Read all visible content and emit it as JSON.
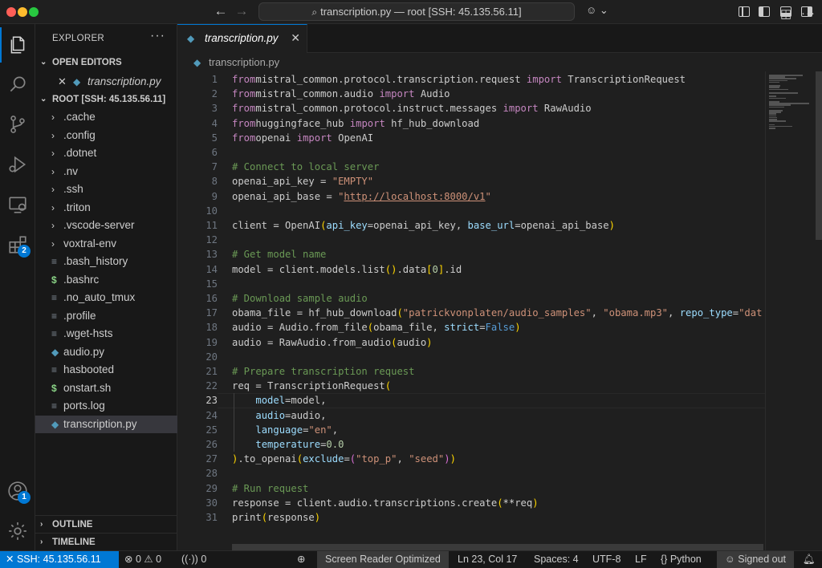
{
  "window": {
    "title": "transcription.py — root [SSH: 45.135.56.11]",
    "back_icon": "arrow-left-icon",
    "forward_icon": "arrow-right-icon",
    "copilot_icon": "copilot-icon"
  },
  "activity_bar": {
    "items": [
      {
        "name": "explorer",
        "icon": "files-icon",
        "active": true
      },
      {
        "name": "search",
        "icon": "search-icon"
      },
      {
        "name": "source-control",
        "icon": "source-control-icon"
      },
      {
        "name": "run-debug",
        "icon": "run-debug-icon"
      },
      {
        "name": "remote-explorer",
        "icon": "remote-explorer-icon"
      },
      {
        "name": "extensions",
        "icon": "extensions-icon",
        "badge": "2"
      }
    ],
    "bottom": [
      {
        "name": "accounts",
        "icon": "account-icon",
        "badge": "1"
      },
      {
        "name": "manage",
        "icon": "gear-icon"
      }
    ]
  },
  "sidebar": {
    "title": "EXPLORER",
    "open_editors_label": "OPEN EDITORS",
    "open_editors": [
      {
        "label": "transcription.py",
        "icon": "python-file-icon"
      }
    ],
    "root_label": "ROOT [SSH: 45.135.56.11]",
    "tree": [
      {
        "label": ".cache",
        "type": "folder"
      },
      {
        "label": ".config",
        "type": "folder"
      },
      {
        "label": ".dotnet",
        "type": "folder"
      },
      {
        "label": ".nv",
        "type": "folder"
      },
      {
        "label": ".ssh",
        "type": "folder"
      },
      {
        "label": ".triton",
        "type": "folder"
      },
      {
        "label": ".vscode-server",
        "type": "folder"
      },
      {
        "label": "voxtral-env",
        "type": "folder"
      },
      {
        "label": ".bash_history",
        "type": "file",
        "icon": "text-file-icon"
      },
      {
        "label": ".bashrc",
        "type": "file",
        "icon": "shell-file-icon"
      },
      {
        "label": ".no_auto_tmux",
        "type": "file",
        "icon": "text-file-icon"
      },
      {
        "label": ".profile",
        "type": "file",
        "icon": "text-file-icon"
      },
      {
        "label": ".wget-hsts",
        "type": "file",
        "icon": "text-file-icon"
      },
      {
        "label": "audio.py",
        "type": "file",
        "icon": "python-file-icon"
      },
      {
        "label": "hasbooted",
        "type": "file",
        "icon": "text-file-icon"
      },
      {
        "label": "onstart.sh",
        "type": "file",
        "icon": "shell-file-icon"
      },
      {
        "label": "ports.log",
        "type": "file",
        "icon": "text-file-icon"
      },
      {
        "label": "transcription.py",
        "type": "file",
        "icon": "python-file-icon",
        "selected": true
      }
    ],
    "outline_label": "OUTLINE",
    "timeline_label": "TIMELINE"
  },
  "editor": {
    "tab_label": "transcription.py",
    "breadcrumb": "transcription.py",
    "current_line": 23,
    "lines": [
      [
        [
          "kw",
          "from"
        ],
        [
          "",
          "mistral_common.protocol.transcription.request "
        ],
        [
          "kw",
          "import"
        ],
        [
          "",
          " TranscriptionRequest"
        ]
      ],
      [
        [
          "kw",
          "from"
        ],
        [
          "",
          "mistral_common.audio "
        ],
        [
          "kw",
          "import"
        ],
        [
          "",
          " Audio"
        ]
      ],
      [
        [
          "kw",
          "from"
        ],
        [
          "",
          "mistral_common.protocol.instruct.messages "
        ],
        [
          "kw",
          "import"
        ],
        [
          "",
          " RawAudio"
        ]
      ],
      [
        [
          "kw",
          "from"
        ],
        [
          "",
          "huggingface_hub "
        ],
        [
          "kw",
          "import"
        ],
        [
          "",
          " hf_hub_download"
        ]
      ],
      [
        [
          "kw",
          "from"
        ],
        [
          "",
          "openai "
        ],
        [
          "kw",
          "import"
        ],
        [
          "",
          " OpenAI"
        ]
      ],
      [],
      [
        [
          "cm",
          "# Connect to local server"
        ]
      ],
      [
        [
          "",
          "openai_api_key = "
        ],
        [
          "st",
          "\"EMPTY\""
        ]
      ],
      [
        [
          "",
          "openai_api_base = "
        ],
        [
          "st",
          "\""
        ],
        [
          "url",
          "http://localhost:8000/v1"
        ],
        [
          "st",
          "\""
        ]
      ],
      [],
      [
        [
          "",
          "client = OpenAI"
        ],
        [
          "br1",
          "("
        ],
        [
          "pa",
          "api_key"
        ],
        [
          "",
          "=openai_api_key, "
        ],
        [
          "pa",
          "base_url"
        ],
        [
          "",
          "=openai_api_base"
        ],
        [
          "br1",
          ")"
        ]
      ],
      [],
      [
        [
          "cm",
          "# Get model name"
        ]
      ],
      [
        [
          "",
          "model = client.models.list"
        ],
        [
          "br1",
          "()"
        ],
        [
          "",
          ".data"
        ],
        [
          "br1",
          "["
        ],
        [
          "num",
          "0"
        ],
        [
          "br1",
          "]"
        ],
        [
          "",
          ".id"
        ]
      ],
      [],
      [
        [
          "cm",
          "# Download sample audio"
        ]
      ],
      [
        [
          "",
          "obama_file = hf_hub_download"
        ],
        [
          "br1",
          "("
        ],
        [
          "st",
          "\"patrickvonplaten/audio_samples\""
        ],
        [
          "",
          ", "
        ],
        [
          "st",
          "\"obama.mp3\""
        ],
        [
          "",
          ", "
        ],
        [
          "pa",
          "repo_type"
        ],
        [
          "",
          "="
        ],
        [
          "st",
          "\"dat"
        ]
      ],
      [
        [
          "",
          "audio = Audio.from_file"
        ],
        [
          "br1",
          "("
        ],
        [
          "",
          "obama_file, "
        ],
        [
          "pa",
          "strict"
        ],
        [
          "",
          "="
        ],
        [
          "bool",
          "False"
        ],
        [
          "br1",
          ")"
        ]
      ],
      [
        [
          "",
          "audio = RawAudio.from_audio"
        ],
        [
          "br1",
          "("
        ],
        [
          "",
          "audio"
        ],
        [
          "br1",
          ")"
        ]
      ],
      [],
      [
        [
          "cm",
          "# Prepare transcription request"
        ]
      ],
      [
        [
          "",
          "req = TranscriptionRequest"
        ],
        [
          "br1",
          "("
        ]
      ],
      [
        [
          "",
          "    "
        ],
        [
          "pa",
          "model"
        ],
        [
          "",
          "=model,"
        ]
      ],
      [
        [
          "",
          "    "
        ],
        [
          "pa",
          "audio"
        ],
        [
          "",
          "=audio,"
        ]
      ],
      [
        [
          "",
          "    "
        ],
        [
          "pa",
          "language"
        ],
        [
          "",
          "="
        ],
        [
          "st",
          "\"en\""
        ],
        [
          "",
          ","
        ]
      ],
      [
        [
          "",
          "    "
        ],
        [
          "pa",
          "temperature"
        ],
        [
          "",
          "="
        ],
        [
          "num",
          "0.0"
        ]
      ],
      [
        [
          "br1",
          ")"
        ],
        [
          "",
          ".to_openai"
        ],
        [
          "br1",
          "("
        ],
        [
          "pa",
          "exclude"
        ],
        [
          "",
          "="
        ],
        [
          "br2",
          "("
        ],
        [
          "st",
          "\"top_p\""
        ],
        [
          "",
          ", "
        ],
        [
          "st",
          "\"seed\""
        ],
        [
          "br2",
          ")"
        ],
        [
          "br1",
          ")"
        ]
      ],
      [],
      [
        [
          "cm",
          "# Run request"
        ]
      ],
      [
        [
          "",
          "response = client.audio.transcriptions.create"
        ],
        [
          "br1",
          "("
        ],
        [
          "op",
          "**"
        ],
        [
          "",
          "req"
        ],
        [
          "br1",
          ")"
        ]
      ],
      [
        [
          "",
          "print"
        ],
        [
          "br1",
          "("
        ],
        [
          "",
          "response"
        ],
        [
          "br1",
          ")"
        ]
      ]
    ]
  },
  "statusbar": {
    "remote": "SSH: 45.135.56.11",
    "problems": "0",
    "warnings": "0",
    "ports": "0",
    "screen_reader": "Screen Reader Optimized",
    "position": "Ln 23, Col 17",
    "spaces": "Spaces: 4",
    "encoding": "UTF-8",
    "eol": "LF",
    "language": "Python",
    "account": "Signed out"
  },
  "colors": {
    "accent": "#0078d4",
    "keyword": "#c586c0",
    "comment": "#6a9955",
    "string": "#ce9178",
    "param": "#9cdcfe"
  }
}
